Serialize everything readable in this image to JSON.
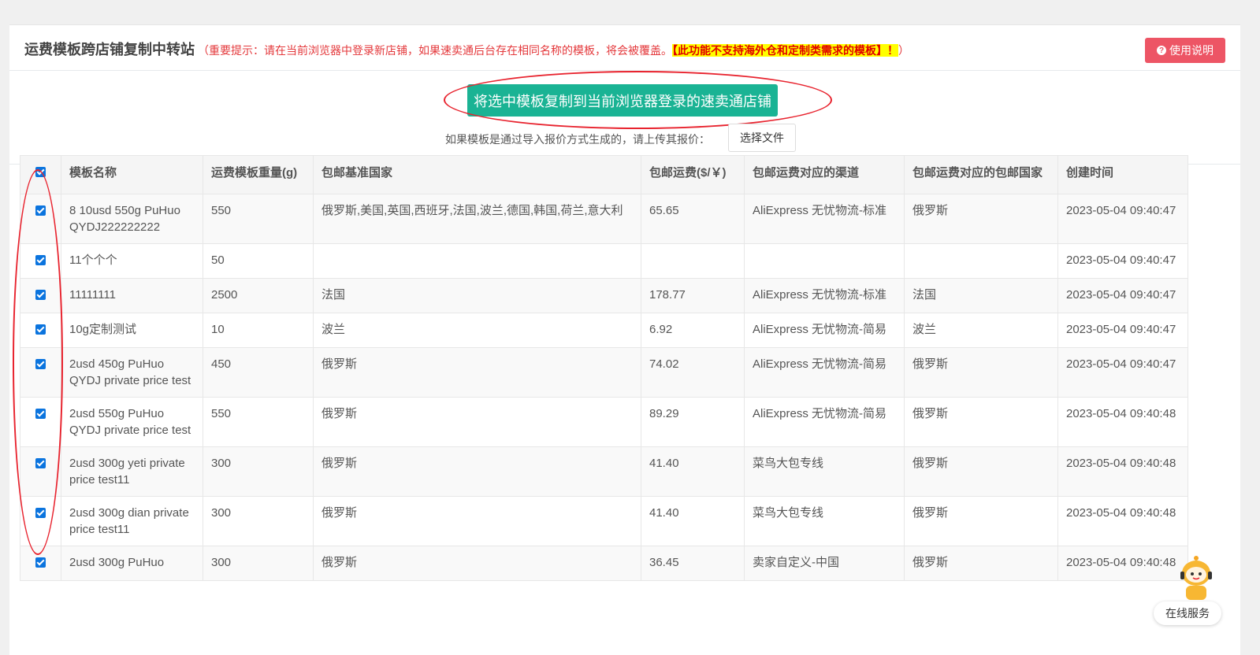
{
  "header": {
    "title": "运费模板跨店铺复制中转站",
    "notice_open": "（重要提示：请在当前浏览器中登录新店铺，如果速卖通后台存在相同名称的模板，将会被覆盖。",
    "notice_highlight": "【此功能不支持海外仓和定制类需求的模板】！",
    "notice_close": "）",
    "help_label": "使用说明"
  },
  "actions": {
    "copy_label": "将选中模板复制到当前浏览器登录的速卖通店铺",
    "upload_text": "如果模板是通过导入报价方式生成的，请上传其报价：",
    "file_label": "选择文件"
  },
  "table": {
    "columns": [
      "模板名称",
      "运费模板重量(g)",
      "包邮基准国家",
      "包邮运费($/￥)",
      "包邮运费对应的渠道",
      "包邮运费对应的包邮国家",
      "创建时间"
    ],
    "rows": [
      {
        "checked": true,
        "name": "8 10usd 550g PuHuo QYDJ222222222",
        "weight": "550",
        "countries": "俄罗斯,美国,英国,西班牙,法国,波兰,德国,韩国,荷兰,意大利",
        "fee": "65.65",
        "channel": "AliExpress 无忧物流-标准",
        "free_country": "俄罗斯",
        "created": "2023-05-04 09:40:47"
      },
      {
        "checked": true,
        "name": "11个个个",
        "weight": "50",
        "countries": "",
        "fee": "",
        "channel": "",
        "free_country": "",
        "created": "2023-05-04 09:40:47"
      },
      {
        "checked": true,
        "name": "11111111",
        "weight": "2500",
        "countries": "法国",
        "fee": "178.77",
        "channel": "AliExpress 无忧物流-标准",
        "free_country": "法国",
        "created": "2023-05-04 09:40:47"
      },
      {
        "checked": true,
        "name": "10g定制测试",
        "weight": "10",
        "countries": "波兰",
        "fee": "6.92",
        "channel": "AliExpress 无忧物流-简易",
        "free_country": "波兰",
        "created": "2023-05-04 09:40:47"
      },
      {
        "checked": true,
        "name": "2usd 450g PuHuo QYDJ private price test",
        "weight": "450",
        "countries": "俄罗斯",
        "fee": "74.02",
        "channel": "AliExpress 无忧物流-简易",
        "free_country": "俄罗斯",
        "created": "2023-05-04 09:40:47"
      },
      {
        "checked": true,
        "name": "2usd 550g PuHuo QYDJ private price test",
        "weight": "550",
        "countries": "俄罗斯",
        "fee": "89.29",
        "channel": "AliExpress 无忧物流-简易",
        "free_country": "俄罗斯",
        "created": "2023-05-04 09:40:48"
      },
      {
        "checked": true,
        "name": "2usd 300g yeti private price test11",
        "weight": "300",
        "countries": "俄罗斯",
        "fee": "41.40",
        "channel": "菜鸟大包专线",
        "free_country": "俄罗斯",
        "created": "2023-05-04 09:40:48"
      },
      {
        "checked": true,
        "name": "2usd 300g dian private price test11",
        "weight": "300",
        "countries": "俄罗斯",
        "fee": "41.40",
        "channel": "菜鸟大包专线",
        "free_country": "俄罗斯",
        "created": "2023-05-04 09:40:48"
      },
      {
        "checked": true,
        "name": "2usd 300g PuHuo",
        "weight": "300",
        "countries": "俄罗斯",
        "fee": "36.45",
        "channel": "卖家自定义-中国",
        "free_country": "俄罗斯",
        "created": "2023-05-04 09:40:48"
      }
    ]
  },
  "service": {
    "label": "在线服务",
    "icon": "robot-icon"
  },
  "colors": {
    "accent_green": "#1ab394",
    "danger_red": "#ed5565",
    "annotation_red": "#e8232e",
    "checkbox_blue": "#0b74de"
  }
}
